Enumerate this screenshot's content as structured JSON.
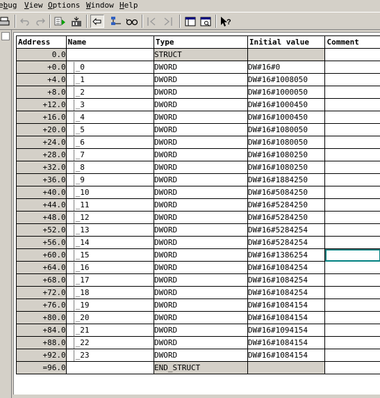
{
  "menu": {
    "items": [
      {
        "pre": "e",
        "ul": "b",
        "post": "ug"
      },
      {
        "pre": "",
        "ul": "V",
        "post": "iew"
      },
      {
        "pre": "",
        "ul": "O",
        "post": "ptions"
      },
      {
        "pre": "",
        "ul": "W",
        "post": "indow"
      },
      {
        "pre": "",
        "ul": "H",
        "post": "elp"
      }
    ]
  },
  "toolbar": {
    "icons": [
      "print-icon",
      "undo-icon",
      "redo-icon",
      "monitor-icon",
      "download-icon",
      "insert-row-icon",
      "network-icon",
      "glasses-icon",
      "breakpoint-start-icon",
      "breakpoint-next-icon",
      "declaration-view-icon",
      "data-view-icon",
      "help-icon"
    ]
  },
  "table": {
    "headers": {
      "address": "Address",
      "name": "Name",
      "type": "Type",
      "initial_value": "Initial value",
      "comment": "Comment"
    },
    "rows": [
      {
        "address": "0.0",
        "name": "",
        "type": "STRUCT",
        "initial_value": "",
        "comment": ""
      },
      {
        "address": "+0.0",
        "name": "_0",
        "type": "DWORD",
        "initial_value": "DW#16#0",
        "comment": ""
      },
      {
        "address": "+4.0",
        "name": "_1",
        "type": "DWORD",
        "initial_value": "DW#16#1008050",
        "comment": ""
      },
      {
        "address": "+8.0",
        "name": "_2",
        "type": "DWORD",
        "initial_value": "DW#16#1000050",
        "comment": ""
      },
      {
        "address": "+12.0",
        "name": "_3",
        "type": "DWORD",
        "initial_value": "DW#16#1000450",
        "comment": ""
      },
      {
        "address": "+16.0",
        "name": "_4",
        "type": "DWORD",
        "initial_value": "DW#16#1000450",
        "comment": ""
      },
      {
        "address": "+20.0",
        "name": "_5",
        "type": "DWORD",
        "initial_value": "DW#16#1080050",
        "comment": ""
      },
      {
        "address": "+24.0",
        "name": "_6",
        "type": "DWORD",
        "initial_value": "DW#16#1080050",
        "comment": ""
      },
      {
        "address": "+28.0",
        "name": "_7",
        "type": "DWORD",
        "initial_value": "DW#16#1080250",
        "comment": ""
      },
      {
        "address": "+32.0",
        "name": "_8",
        "type": "DWORD",
        "initial_value": "DW#16#1080250",
        "comment": ""
      },
      {
        "address": "+36.0",
        "name": "_9",
        "type": "DWORD",
        "initial_value": "DW#16#1884250",
        "comment": ""
      },
      {
        "address": "+40.0",
        "name": "_10",
        "type": "DWORD",
        "initial_value": "DW#16#5084250",
        "comment": ""
      },
      {
        "address": "+44.0",
        "name": "_11",
        "type": "DWORD",
        "initial_value": "DW#16#5284250",
        "comment": ""
      },
      {
        "address": "+48.0",
        "name": "_12",
        "type": "DWORD",
        "initial_value": "DW#16#5284250",
        "comment": ""
      },
      {
        "address": "+52.0",
        "name": "_13",
        "type": "DWORD",
        "initial_value": "DW#16#5284254",
        "comment": ""
      },
      {
        "address": "+56.0",
        "name": "_14",
        "type": "DWORD",
        "initial_value": "DW#16#5284254",
        "comment": ""
      },
      {
        "address": "+60.0",
        "name": "_15",
        "type": "DWORD",
        "initial_value": "DW#16#1386254",
        "comment": "",
        "selected": true
      },
      {
        "address": "+64.0",
        "name": "_16",
        "type": "DWORD",
        "initial_value": "DW#16#1084254",
        "comment": ""
      },
      {
        "address": "+68.0",
        "name": "_17",
        "type": "DWORD",
        "initial_value": "DW#16#1084254",
        "comment": ""
      },
      {
        "address": "+72.0",
        "name": "_18",
        "type": "DWORD",
        "initial_value": "DW#16#1084254",
        "comment": ""
      },
      {
        "address": "+76.0",
        "name": "_19",
        "type": "DWORD",
        "initial_value": "DW#16#1084154",
        "comment": ""
      },
      {
        "address": "+80.0",
        "name": "_20",
        "type": "DWORD",
        "initial_value": "DW#16#1084154",
        "comment": ""
      },
      {
        "address": "+84.0",
        "name": "_21",
        "type": "DWORD",
        "initial_value": "DW#16#1094154",
        "comment": ""
      },
      {
        "address": "+88.0",
        "name": "_22",
        "type": "DWORD",
        "initial_value": "DW#16#1084154",
        "comment": ""
      },
      {
        "address": "+92.0",
        "name": "_23",
        "type": "DWORD",
        "initial_value": "DW#16#1084154",
        "comment": ""
      },
      {
        "address": "=96.0",
        "name": "",
        "type": "END_STRUCT",
        "initial_value": "",
        "comment": ""
      }
    ]
  },
  "colors": {
    "selection": "#008080",
    "chrome": "#d4d0c8"
  }
}
